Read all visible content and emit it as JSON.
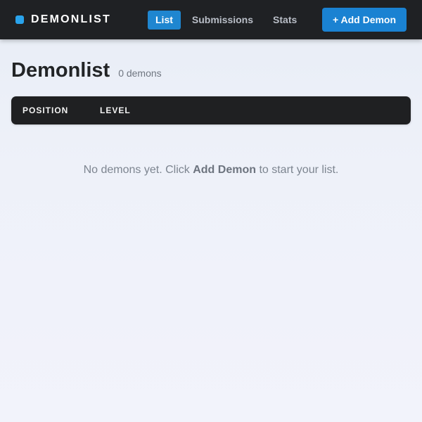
{
  "app": {
    "brand_name": "DEMONLIST"
  },
  "nav": {
    "items": [
      {
        "label": "List",
        "active": true
      },
      {
        "label": "Submissions",
        "active": false
      },
      {
        "label": "Stats",
        "active": false
      }
    ]
  },
  "toolbar": {
    "add_label": "+ Add Demon"
  },
  "page": {
    "title": "Demonlist",
    "count_text": "0 demons"
  },
  "table": {
    "columns": [
      "POSITION",
      "LEVEL"
    ]
  },
  "empty_state": {
    "prefix": "No demons yet. Click ",
    "emphasis": "Add Demon",
    "suffix": " to start your list."
  },
  "colors": {
    "accent": "#1f86d0",
    "topbar": "#1f2124",
    "brand_mark": "#29a3ec"
  }
}
